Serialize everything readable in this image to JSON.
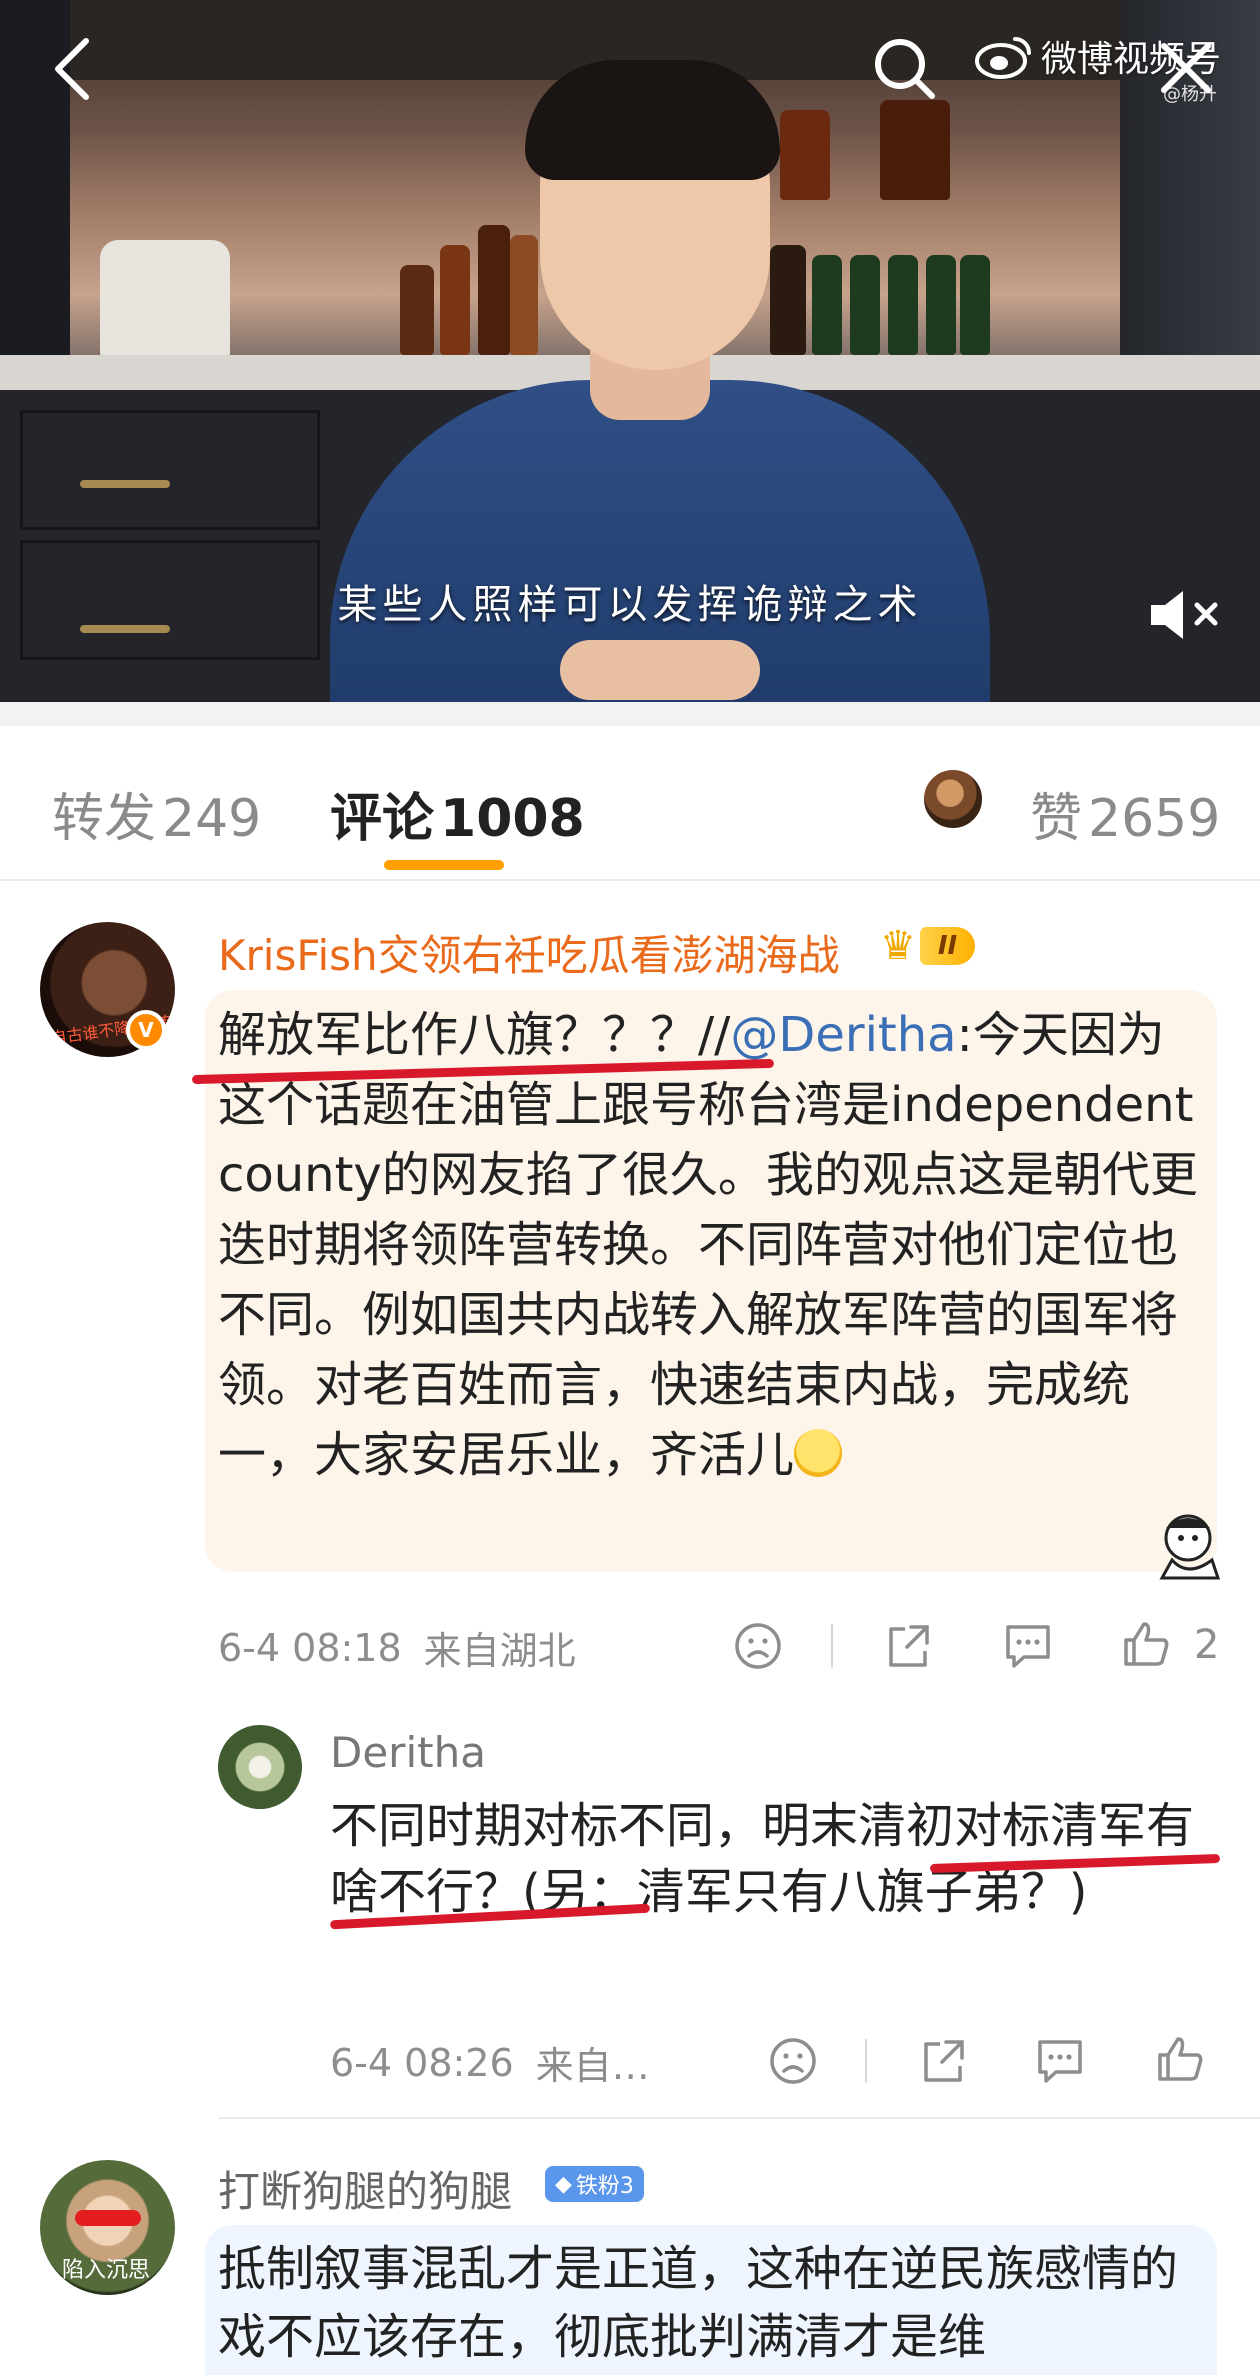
{
  "video": {
    "brand_name": "微博视频号",
    "brand_sub": "@杨升",
    "subtitle": "某些人照样可以发挥诡辩之术"
  },
  "tabs": {
    "repost_label": "转发",
    "repost_count": "249",
    "comment_label": "评论",
    "comment_count": "1008",
    "like_label": "赞",
    "like_count": "2659"
  },
  "comment1": {
    "username": "KrisFish交领右衽吃瓜看澎湖海战",
    "level_badge": "II",
    "text_before_mention": "解放军比作八旗？？？//",
    "mention": "@Deritha",
    "text_after_mention": ":今天因为这个话题在油管上跟号称台湾是independent county的网友掐了很久。我的观点这是朝代更迭时期将领阵营转换。不同阵营对他们定位也不同。例如国共内战转入解放军阵营的国军将领。对老百姓而言，快速结束内战，完成统一，大家安居乐业，齐活儿",
    "time": "6-4 08:18",
    "location": "来自湖北",
    "like_count": "2",
    "avatar_text": "自古谁不降? 留有后…",
    "verified_mark": "V"
  },
  "reply1": {
    "username": "Deritha",
    "text": "不同时期对标不同，明末清初对标清军有啥不行？(另：清军只有八旗子弟？)",
    "time": "6-4 08:26",
    "location": "来自…"
  },
  "comment3": {
    "username": "打断狗腿的狗腿",
    "fan_badge": "铁粉3",
    "avatar_text": "陷入沉思",
    "text": "抵制叙事混乱才是正道，这种在逆民族感情的戏不应该存在，彻底批判满清才是维"
  }
}
